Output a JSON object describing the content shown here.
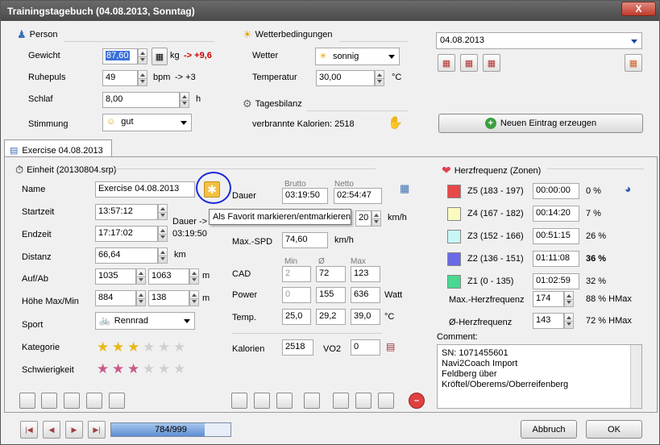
{
  "window": {
    "title": "Trainingstagebuch (04.08.2013, Sonntag)",
    "close_label": "X"
  },
  "person": {
    "title": "Person",
    "weight_label": "Gewicht",
    "weight_value": "87,60",
    "weight_unit": "kg",
    "weight_delta": "-> +9,6",
    "pulse_label": "Ruhepuls",
    "pulse_value": "49",
    "pulse_unit": "bpm",
    "pulse_delta": "-> +3",
    "sleep_label": "Schlaf",
    "sleep_value": "8,00",
    "sleep_unit": "h",
    "mood_label": "Stimmung",
    "mood_value": "gut"
  },
  "weather": {
    "title": "Wetterbedingungen",
    "weather_label": "Wetter",
    "weather_value": "sonnig",
    "temp_label": "Temperatur",
    "temp_value": "30,00",
    "temp_unit": "°C"
  },
  "balance": {
    "title": "Tagesbilanz",
    "text": "verbrannte Kalorien: 2518"
  },
  "date": {
    "value": "04.08.2013"
  },
  "new_entry_label": "Neuen Eintrag erzeugen",
  "tab": {
    "label": "Exercise 04.08.2013"
  },
  "unit": {
    "title": "Einheit (20130804.srp)",
    "name_label": "Name",
    "name_value": "Exercise 04.08.2013",
    "start_label": "Startzeit",
    "start_value": "13:57:12",
    "end_label": "Endzeit",
    "end_value": "17:17:02",
    "duration_label": "Dauer ->",
    "duration_value": "03:19:50",
    "distance_label": "Distanz",
    "distance_value": "66,64",
    "distance_unit": "km",
    "updown_label": "Auf/Ab",
    "up_value": "1035",
    "down_value": "1063",
    "updown_unit": "m",
    "height_label": "Höhe Max/Min",
    "hmax_value": "884",
    "hmin_value": "138",
    "height_unit": "m",
    "sport_label": "Sport",
    "sport_value": "Rennrad",
    "category_label": "Kategorie",
    "category_stars": 3,
    "difficulty_label": "Schwierigkeit",
    "difficulty_stars": 3,
    "max_stars": 6
  },
  "tooltip": "Als Favorit markieren/entmarkieren",
  "metrics": {
    "brutto_label": "Brutto",
    "netto_label": "Netto",
    "dauer_label": "Dauer",
    "brutto_value": "03:19:50",
    "netto_value": "02:54:47",
    "speed_value": "20",
    "speed_unit": "km/h",
    "maxspd_label": "Max.-SPD",
    "maxspd_value": "74,60",
    "maxspd_unit": "km/h",
    "min_label": "Min",
    "avg_label": "Ø",
    "max_label": "Max",
    "cad_label": "CAD",
    "cad_min": "2",
    "cad_avg": "72",
    "cad_max": "123",
    "power_label": "Power",
    "power_min": "0",
    "power_avg": "155",
    "power_max": "636",
    "power_unit": "Watt",
    "temp_label": "Temp.",
    "temp_min": "25,0",
    "temp_avg": "29,2",
    "temp_max": "39,0",
    "temp_unit": "°C",
    "kal_label": "Kalorien",
    "kal_value": "2518",
    "vo2_label": "VO2",
    "vo2_value": "0"
  },
  "hr": {
    "title": "Herzfrequenz (Zonen)",
    "zones": [
      {
        "label": "Z5 (183 - 197)",
        "time": "00:00:00",
        "pct": "0 %",
        "color": "#e84848"
      },
      {
        "label": "Z4 (167 - 182)",
        "time": "00:14:20",
        "pct": "7 %",
        "color": "#fafac0"
      },
      {
        "label": "Z3 (152 - 166)",
        "time": "00:51:15",
        "pct": "26 %",
        "color": "#c8f6f6"
      },
      {
        "label": "Z2 (136 - 151)",
        "time": "01:11:08",
        "pct": "36 %",
        "color": "#6a6ae8"
      },
      {
        "label": "Z1 (0 - 135)",
        "time": "01:02:59",
        "pct": "32 %",
        "color": "#48d890"
      }
    ],
    "max_label": "Max.-Herzfrequenz",
    "max_value": "174",
    "max_pct": "88 % HMax",
    "avg_label": "Ø-Herzfrequenz",
    "avg_value": "143",
    "avg_pct": "72 % HMax"
  },
  "comment": {
    "label": "Comment:",
    "text": "SN: 1071455601\nNavi2Coach Import\nFeldberg über\nKröftel/Oberems/Oberreifenberg"
  },
  "footer": {
    "progress_text": "784/999",
    "progress_fraction": 0.785,
    "cancel_label": "Abbruch",
    "ok_label": "OK"
  },
  "colors": {
    "accent_red": "#d00000",
    "circle": "#1a2bd8",
    "progress": "#5f8fd3"
  }
}
